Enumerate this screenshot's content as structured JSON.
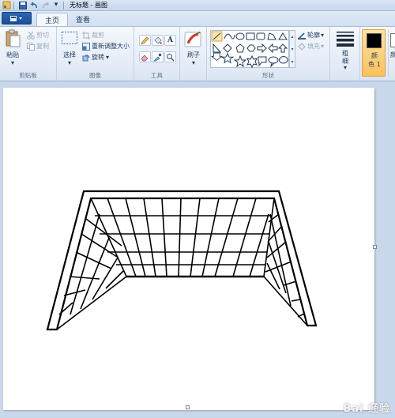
{
  "window": {
    "title": "无标题 - 画图"
  },
  "quick_access": {
    "save_icon": "save-icon",
    "undo_icon": "undo-icon",
    "redo_icon": "redo-icon",
    "customize_icon": "dropdown-icon"
  },
  "tabs": [
    {
      "label": "主页",
      "active": true
    },
    {
      "label": "查看",
      "active": false
    }
  ],
  "ribbon": {
    "clipboard": {
      "paste": "粘贴",
      "cut": "剪切",
      "copy": "复制",
      "group": "剪贴板"
    },
    "image": {
      "select": "选择",
      "crop": "裁剪",
      "resize": "重新调整大小",
      "rotate": "旋转",
      "group": "图像"
    },
    "tools": {
      "group": "工具"
    },
    "brushes": {
      "label": "刷子"
    },
    "shapes": {
      "outline": "轮廓",
      "fill": "填充",
      "group": "形状"
    },
    "size": {
      "label_1": "粗",
      "label_2": "细"
    },
    "colors": {
      "color1_a": "颜",
      "color1_b": "色 1",
      "color2": "颜"
    }
  },
  "colors": {
    "accent": "#f9c25a",
    "ribbon_bg": "#e4ecf7",
    "workspace_bg": "#c9d7ea",
    "color1": "#000000",
    "color2": "#ffffff"
  },
  "watermark": {
    "text": "Bai 经验"
  }
}
